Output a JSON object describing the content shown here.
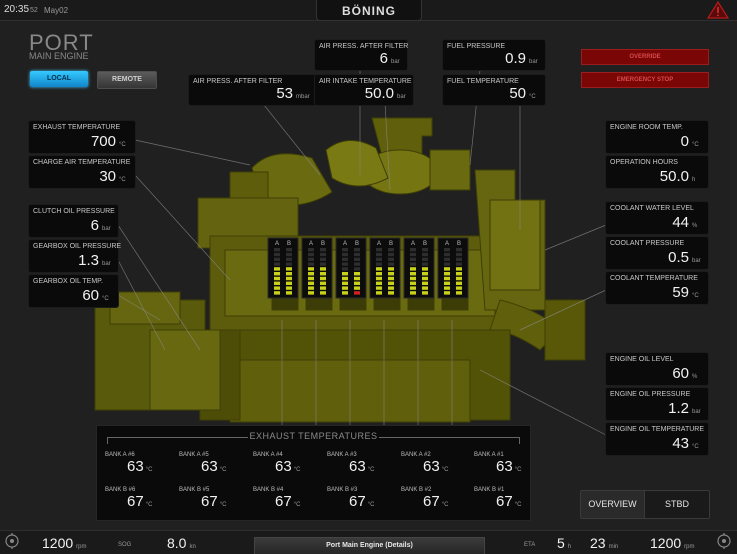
{
  "topbar": {
    "time": "20:35",
    "seconds": "52",
    "date": "May02",
    "brand": "BÖNING"
  },
  "engine": {
    "title": "PORT",
    "subtitle": "MAIN ENGINE",
    "local_label": "LOCAL",
    "remote_label": "REMOTE"
  },
  "warnings": {
    "override": "OVERRIDE",
    "emergency_stop": "EMERGENCY STOP"
  },
  "readings": {
    "air_press_after_filter_top": {
      "label": "AIR PRESS. AFTER FILTER",
      "value": "6",
      "unit": "bar"
    },
    "fuel_pressure": {
      "label": "FUEL PRESSURE",
      "value": "0.9",
      "unit": "bar"
    },
    "air_press_after_filter": {
      "label": "AIR PRESS. AFTER FILTER",
      "value": "53",
      "unit": "mbar"
    },
    "air_intake_temperature": {
      "label": "AIR INTAKE TEMPERATURE",
      "value": "50.0",
      "unit": "bar"
    },
    "fuel_temperature": {
      "label": "FUEL TEMPERATURE",
      "value": "50",
      "unit": "°C"
    },
    "exhaust_temperature": {
      "label": "EXHAUST TEMPERATURE",
      "value": "700",
      "unit": "°C"
    },
    "charge_air_temperature": {
      "label": "CHARGE AIR TEMPERATURE",
      "value": "30",
      "unit": "°C"
    },
    "clutch_oil_pressure": {
      "label": "CLUTCH OIL PRESSURE",
      "value": "6",
      "unit": "bar"
    },
    "gearbox_oil_pressure": {
      "label": "GEARBOX OIL PRESSURE",
      "value": "1.3",
      "unit": "bar"
    },
    "gearbox_oil_temp": {
      "label": "GEARBOX OIL TEMP.",
      "value": "60",
      "unit": "°C"
    },
    "engine_room_temp": {
      "label": "ENGINE ROOM TEMP.",
      "value": "0",
      "unit": "°C"
    },
    "operation_hours": {
      "label": "OPERATION HOURS",
      "value": "50.0",
      "unit": "h"
    },
    "coolant_water_level": {
      "label": "COOLANT WATER LEVEL",
      "value": "44",
      "unit": "%"
    },
    "coolant_pressure": {
      "label": "COOLANT PRESSURE",
      "value": "0.5",
      "unit": "bar"
    },
    "coolant_temperature": {
      "label": "COOLANT TEMPERATURE",
      "value": "59",
      "unit": "°C"
    },
    "engine_oil_level": {
      "label": "ENGINE OIL LEVEL",
      "value": "60",
      "unit": "%"
    },
    "engine_oil_pressure": {
      "label": "ENGINE OIL PRESSURE",
      "value": "1.2",
      "unit": "bar"
    },
    "engine_oil_temperature": {
      "label": "ENGINE OIL TEMPERATURE",
      "value": "43",
      "unit": "°C"
    }
  },
  "cylinder_bars": {
    "labels": [
      "A",
      "B"
    ],
    "levels": [
      [
        0.55,
        0.55
      ],
      [
        0.55,
        0.55
      ],
      [
        0.5,
        0.5
      ],
      [
        0.55,
        0.55
      ],
      [
        0.55,
        0.55
      ],
      [
        0.55,
        0.55
      ]
    ]
  },
  "exhaust": {
    "title": "EXHAUST TEMPERATURES",
    "bank_a": [
      {
        "label": "BANK A #6",
        "value": "63",
        "unit": "°C"
      },
      {
        "label": "BANK A #5",
        "value": "63",
        "unit": "°C"
      },
      {
        "label": "BANK A #4",
        "value": "63",
        "unit": "°C"
      },
      {
        "label": "BANK A #3",
        "value": "63",
        "unit": "°C"
      },
      {
        "label": "BANK A #2",
        "value": "63",
        "unit": "°C"
      },
      {
        "label": "BANK A #1",
        "value": "63",
        "unit": "°C"
      }
    ],
    "bank_b": [
      {
        "label": "BANK B #6",
        "value": "67",
        "unit": "°C"
      },
      {
        "label": "BANK B #5",
        "value": "67",
        "unit": "°C"
      },
      {
        "label": "BANK B #4",
        "value": "67",
        "unit": "°C"
      },
      {
        "label": "BANK B #3",
        "value": "67",
        "unit": "°C"
      },
      {
        "label": "BANK B #2",
        "value": "67",
        "unit": "°C"
      },
      {
        "label": "BANK B #1",
        "value": "67",
        "unit": "°C"
      }
    ]
  },
  "nav": {
    "overview": "OVERVIEW",
    "stbd": "STBD"
  },
  "bottombar": {
    "port_rpm": {
      "value": "1200",
      "unit": "rpm"
    },
    "sog": {
      "label": "SOG",
      "value": "8.0",
      "unit": "kn"
    },
    "details": "Port Main Engine (Details)",
    "eta": {
      "label": "ETA",
      "hours": "5",
      "hours_unit": "h",
      "minutes": "23",
      "minutes_unit": "min"
    },
    "stbd_rpm": {
      "value": "1200",
      "unit": "rpm"
    }
  },
  "colors": {
    "engine": "#8a8a10",
    "accent": "#1fa8ee",
    "warning": "#7a0606"
  }
}
